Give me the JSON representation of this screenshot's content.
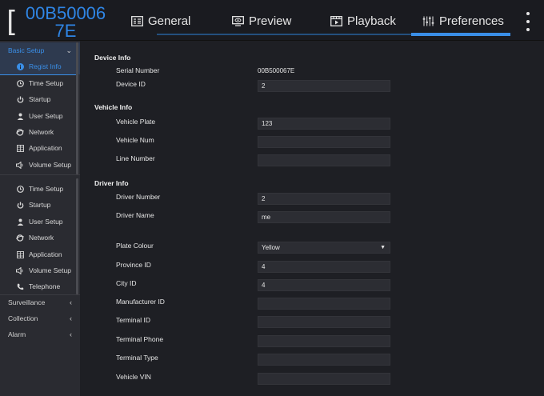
{
  "device": {
    "bracket": "[",
    "code": "00B500067E"
  },
  "tabs": [
    {
      "label": "General",
      "icon": "id-card-icon"
    },
    {
      "label": "Preview",
      "icon": "monitor-eye-icon"
    },
    {
      "label": "Playback",
      "icon": "film-icon"
    },
    {
      "label": "Preferences",
      "icon": "sliders-icon",
      "active": true
    }
  ],
  "sidebar": {
    "group_basic": "Basic Setup",
    "items_a": [
      {
        "label": "Regist Info",
        "icon": "info-icon",
        "active": true
      },
      {
        "label": "Time Setup",
        "icon": "clock-icon"
      },
      {
        "label": "Startup",
        "icon": "power-icon"
      },
      {
        "label": "User Setup",
        "icon": "user-icon"
      },
      {
        "label": "Network",
        "icon": "globe-icon"
      },
      {
        "label": "Application",
        "icon": "grid-icon"
      },
      {
        "label": "Volume Setup",
        "icon": "speaker-icon"
      }
    ],
    "items_b": [
      {
        "label": "Time Setup",
        "icon": "clock-icon"
      },
      {
        "label": "Startup",
        "icon": "power-icon"
      },
      {
        "label": "User Setup",
        "icon": "user-icon"
      },
      {
        "label": "Network",
        "icon": "globe-icon"
      },
      {
        "label": "Application",
        "icon": "grid-icon"
      },
      {
        "label": "Volume Setup",
        "icon": "speaker-icon"
      },
      {
        "label": "Telephone",
        "icon": "phone-icon"
      }
    ],
    "group_surveillance": "Surveillance",
    "group_collection": "Collection",
    "group_alarm": "Alarm"
  },
  "form": {
    "device_info": {
      "title": "Device Info",
      "serial_label": "Serial Number",
      "serial_value": "00B500067E",
      "device_id_label": "Device ID",
      "device_id_value": "2"
    },
    "vehicle_info": {
      "title": "Vehicle Info",
      "plate_label": "Vehicle Plate",
      "plate_value": "123",
      "num_label": "Vehicle Num",
      "num_value": "",
      "line_label": "Line Number",
      "line_value": ""
    },
    "driver_info": {
      "title": "Driver Info",
      "driver_number_label": "Driver Number",
      "driver_number_value": "2",
      "driver_name_label": "Driver Name",
      "driver_name_value": "me",
      "plate_colour_label": "Plate Colour",
      "plate_colour_value": "Yellow",
      "province_label": "Province ID",
      "province_value": "4",
      "city_label": "City ID",
      "city_value": "4",
      "manufacturer_label": "Manufacturer ID",
      "manufacturer_value": "",
      "terminal_id_label": "Terminal ID",
      "terminal_id_value": "",
      "terminal_phone_label": "Terminal Phone",
      "terminal_phone_value": "",
      "terminal_type_label": "Terminal Type",
      "terminal_type_value": "",
      "vin_label": "Vehicle VIN",
      "vin_value": ""
    }
  },
  "colors": {
    "accent": "#3a8fe8",
    "background": "#1e1f24",
    "sidebar": "#2a2b31"
  }
}
